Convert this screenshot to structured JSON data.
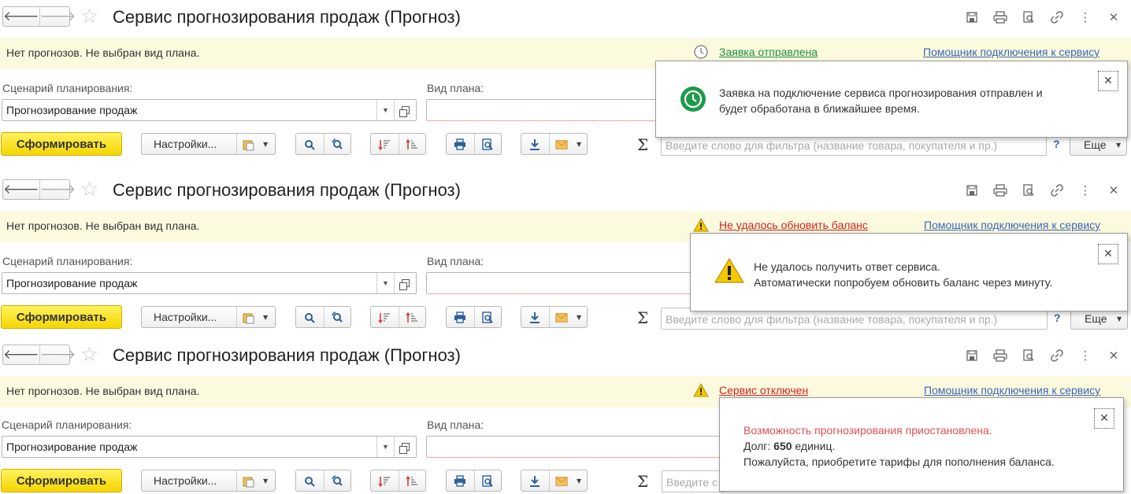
{
  "common": {
    "back_icon": "arrow-left-icon",
    "forward_icon": "arrow-right-icon",
    "favorite_icon": "star-icon",
    "title": "Сервис прогнозирования продаж (Прогноз)",
    "window_tools": [
      "save-icon",
      "print-icon",
      "preview-icon",
      "link-icon",
      "more-icon",
      "close-icon"
    ],
    "info_message": "Нет прогнозов. Не выбран вид плана.",
    "help_link": "Помощник подключения к сервису",
    "scenario_label": "Сценарий планирования:",
    "scenario_value": "Прогнозирование продаж",
    "plan_label": "Вид плана:",
    "plan_value": "",
    "generate_button": "Сформировать",
    "settings_button": "Настройки...",
    "filter_placeholder": "Введите слово для фильтра (название товара, покупателя и пр.)",
    "filter_placeholder_short": "Введите с",
    "help_q": "?",
    "more_button": "Еще",
    "sigma": "Σ"
  },
  "panels": [
    {
      "status_text": "Заявка отправлена",
      "status_color": "#1e8f3e",
      "status_icon": "clock-icon",
      "popup_icon": "green-clock-icon",
      "popup_lines": [
        "Заявка на подключение сервиса прогнозирования отправлен и",
        "будет обработана в ближайшее время."
      ]
    },
    {
      "status_text": "Не удалось обновить баланс",
      "status_color": "#d61f1f",
      "status_icon": "warning-icon",
      "popup_icon": "warning-icon",
      "popup_lines": [
        "Не удалось получить ответ сервиса.",
        "Автоматически попробуем обновить баланс через минуту."
      ]
    },
    {
      "status_text": "Сервис отключен",
      "status_color": "#d61f1f",
      "status_icon": "warning-icon",
      "popup_line1": "Возможность прогнозирования приостановлена.",
      "popup_debt_prefix": "Долг: ",
      "popup_debt_value": "650",
      "popup_debt_suffix": " единиц.",
      "popup_line3": "Пожалуйста, приобретите тарифы для пополнения баланса."
    }
  ],
  "colors": {
    "info_bg": "#fbfadf",
    "accent_yellow": "#f5d600",
    "link_blue": "#3a66b6",
    "error_red": "#e05050"
  }
}
